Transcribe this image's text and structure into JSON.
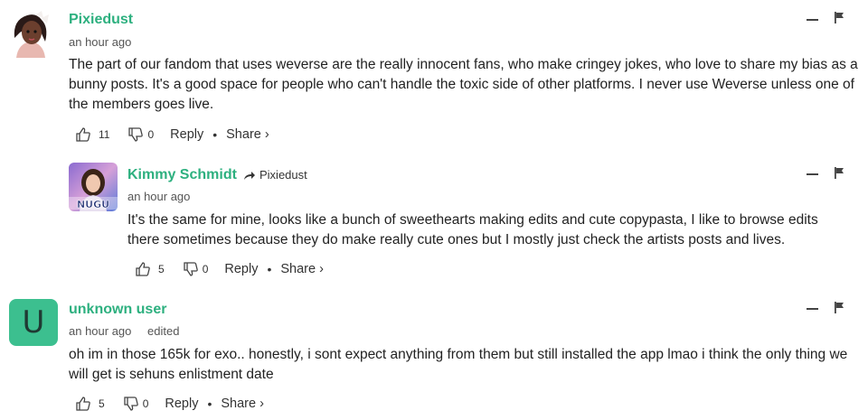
{
  "colors": {
    "accent": "#2db07f",
    "avatar_bg": "#3cbf8f"
  },
  "comments": [
    {
      "author": "Pixiedust",
      "time": "an hour ago",
      "text": "The part of our fandom that uses weverse are the really innocent fans, who make cringey jokes, who love to share my bias as a bunny posts. It's a good space for people who can't handle the toxic side of other platforms. I never use Weverse unless one of the members goes live.",
      "likes": "11",
      "dislikes": "0",
      "reply_label": "Reply",
      "share_label": "Share ›",
      "icons": {
        "like": "thumbs-up-icon",
        "dislike": "thumbs-down-icon",
        "collapse": "minus-icon",
        "flag": "flag-icon"
      }
    },
    {
      "author": "Kimmy Schmidt",
      "reply_to": "Pixiedust",
      "time": "an hour ago",
      "avatar_text": "NUGU",
      "text": "It's the same for mine, looks like a bunch of sweethearts making edits and cute copypasta, I like to browse edits there sometimes because they do make really cute ones but I mostly just check the artists posts and lives.",
      "likes": "5",
      "dislikes": "0",
      "reply_label": "Reply",
      "share_label": "Share ›"
    },
    {
      "author": "unknown user",
      "avatar_letter": "U",
      "time": "an hour ago",
      "edited": "edited",
      "text": "oh im in those 165k for exo.. honestly, i sont expect anything from them but still installed the app lmao i think the only thing we will get is sehuns enlistment date",
      "likes": "5",
      "dislikes": "0",
      "reply_label": "Reply",
      "share_label": "Share ›"
    }
  ]
}
